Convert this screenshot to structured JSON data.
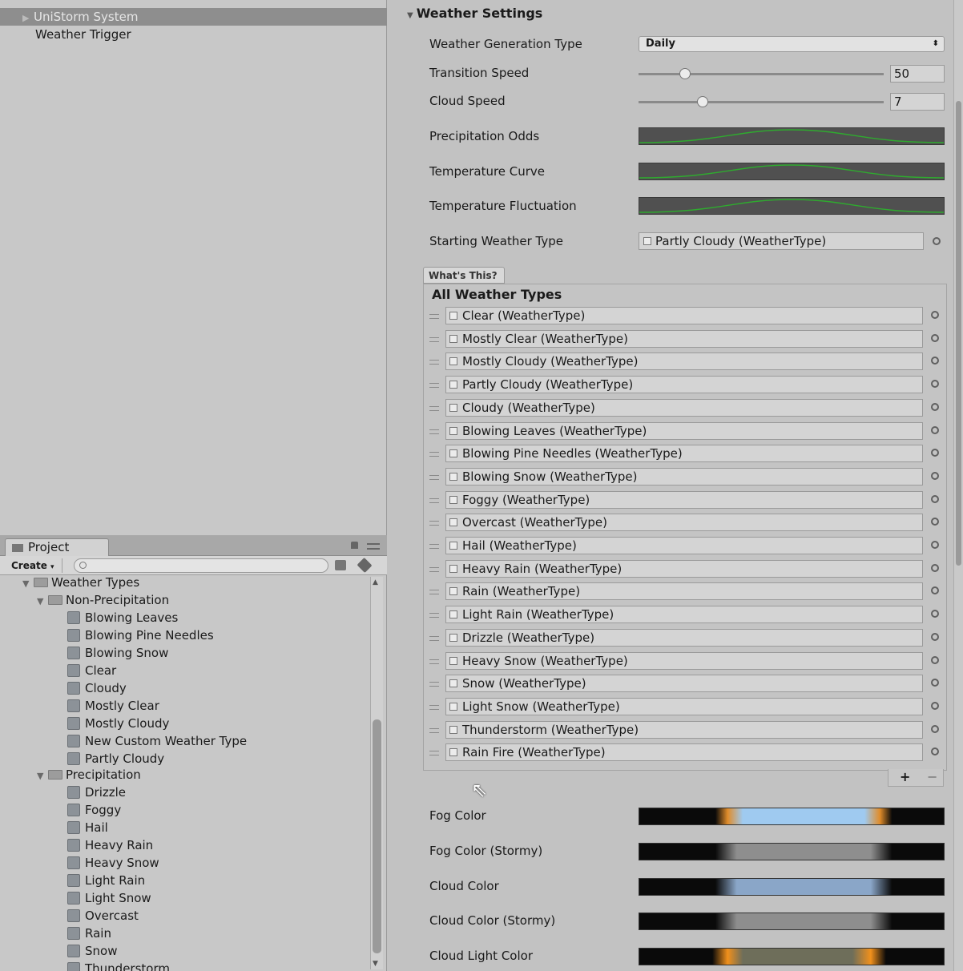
{
  "hierarchy": {
    "items": [
      {
        "label": "UniStorm System",
        "selected": true
      },
      {
        "label": "Weather Trigger",
        "selected": false
      }
    ]
  },
  "project": {
    "tab_label": "Project",
    "create_label": "Create",
    "search_placeholder": "",
    "tree": {
      "root": "Weather Types",
      "groups": [
        {
          "label": "Non-Precipitation",
          "items": [
            "Blowing Leaves",
            "Blowing Pine Needles",
            "Blowing Snow",
            "Clear",
            "Cloudy",
            "Mostly Clear",
            "Mostly Cloudy",
            "New Custom Weather Type",
            "Partly Cloudy"
          ]
        },
        {
          "label": "Precipitation",
          "items": [
            "Drizzle",
            "Foggy",
            "Hail",
            "Heavy Rain",
            "Heavy Snow",
            "Light Rain",
            "Light Snow",
            "Overcast",
            "Rain",
            "Snow",
            "Thunderstorm"
          ]
        }
      ]
    }
  },
  "inspector": {
    "section_title": "Weather Settings",
    "weather_generation_type": {
      "label": "Weather Generation Type",
      "value": "Daily"
    },
    "transition_speed": {
      "label": "Transition Speed",
      "value": "50",
      "fraction": 0.19
    },
    "cloud_speed": {
      "label": "Cloud Speed",
      "value": "7",
      "fraction": 0.26
    },
    "precipitation_odds": {
      "label": "Precipitation Odds"
    },
    "temperature_curve": {
      "label": "Temperature Curve"
    },
    "temperature_fluctuation": {
      "label": "Temperature Fluctuation"
    },
    "starting_weather_type": {
      "label": "Starting Weather Type",
      "value": "Partly Cloudy (WeatherType)"
    },
    "whats_this_label": "What's This?",
    "all_weather_types_label": "All Weather Types",
    "weather_types": [
      "Clear (WeatherType)",
      "Mostly Clear (WeatherType)",
      "Mostly Cloudy (WeatherType)",
      "Partly Cloudy (WeatherType)",
      "Cloudy (WeatherType)",
      "Blowing Leaves (WeatherType)",
      "Blowing Pine Needles (WeatherType)",
      "Blowing Snow (WeatherType)",
      "Foggy (WeatherType)",
      "Overcast (WeatherType)",
      "Hail (WeatherType)",
      "Heavy Rain (WeatherType)",
      "Rain (WeatherType)",
      "Light Rain (WeatherType)",
      "Drizzle (WeatherType)",
      "Heavy Snow (WeatherType)",
      "Snow (WeatherType)",
      "Light Snow (WeatherType)",
      "Thunderstorm (WeatherType)",
      "Rain Fire (WeatherType)"
    ],
    "add_label": "+",
    "remove_label": "−",
    "fog_color": {
      "label": "Fog Color"
    },
    "fog_color_stormy": {
      "label": "Fog Color (Stormy)"
    },
    "cloud_color": {
      "label": "Cloud Color"
    },
    "cloud_color_stormy": {
      "label": "Cloud Color (Stormy)"
    },
    "cloud_light_color": {
      "label": "Cloud Light Color"
    }
  },
  "colors": {
    "curve_line": "#2faa2f",
    "fog_light": "#9fcaf0",
    "fog_edge": "#e08c2a",
    "cloud_light": "#8aa6c8",
    "stormy_gray": "#8e8e8e",
    "cloud_light_orange": "#f0901c",
    "cloud_light_mid": "#6e6e5a"
  }
}
